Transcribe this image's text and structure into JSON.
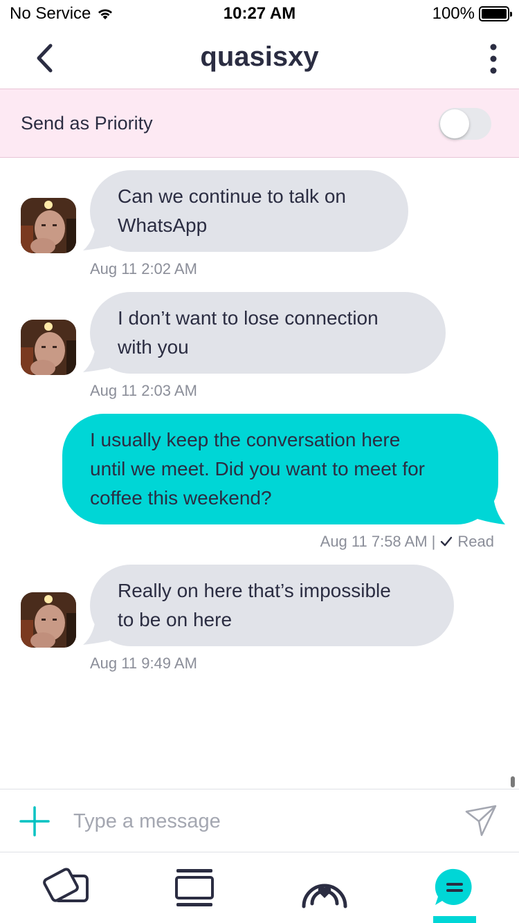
{
  "status_bar": {
    "carrier": "No Service",
    "time": "10:27 AM",
    "battery": "100%"
  },
  "header": {
    "title": "quasisxy"
  },
  "priority": {
    "label": "Send as Priority",
    "enabled": false
  },
  "messages": [
    {
      "direction": "incoming",
      "lines": [
        "Can we continue to talk on",
        "WhatsApp"
      ],
      "timestamp": "Aug 11 2:02 AM"
    },
    {
      "direction": "incoming",
      "lines": [
        "I don’t want to lose connection",
        "with you"
      ],
      "timestamp": "Aug 11 2:03 AM"
    },
    {
      "direction": "outgoing",
      "lines": [
        "I usually keep the conversation here",
        "until we meet. Did you want to meet for",
        "coffee this weekend?"
      ],
      "timestamp": "Aug 11 7:58 AM |",
      "status": "Read"
    },
    {
      "direction": "incoming",
      "lines": [
        "Really on here that’s impossible",
        "to be on here"
      ],
      "timestamp": "Aug 11 9:49 AM"
    }
  ],
  "composer": {
    "placeholder": "Type a message"
  },
  "tabs": [
    {
      "icon": "cards-icon",
      "active": false
    },
    {
      "icon": "browse-icon",
      "active": false
    },
    {
      "icon": "heart-signal-icon",
      "active": false
    },
    {
      "icon": "chat-icon",
      "active": true
    }
  ],
  "colors": {
    "accent": "#00d6d6",
    "incoming_bubble": "#e1e3e9",
    "priority_bg": "#fde9f3",
    "text": "#2b2d42",
    "meta": "#8b8e99"
  }
}
